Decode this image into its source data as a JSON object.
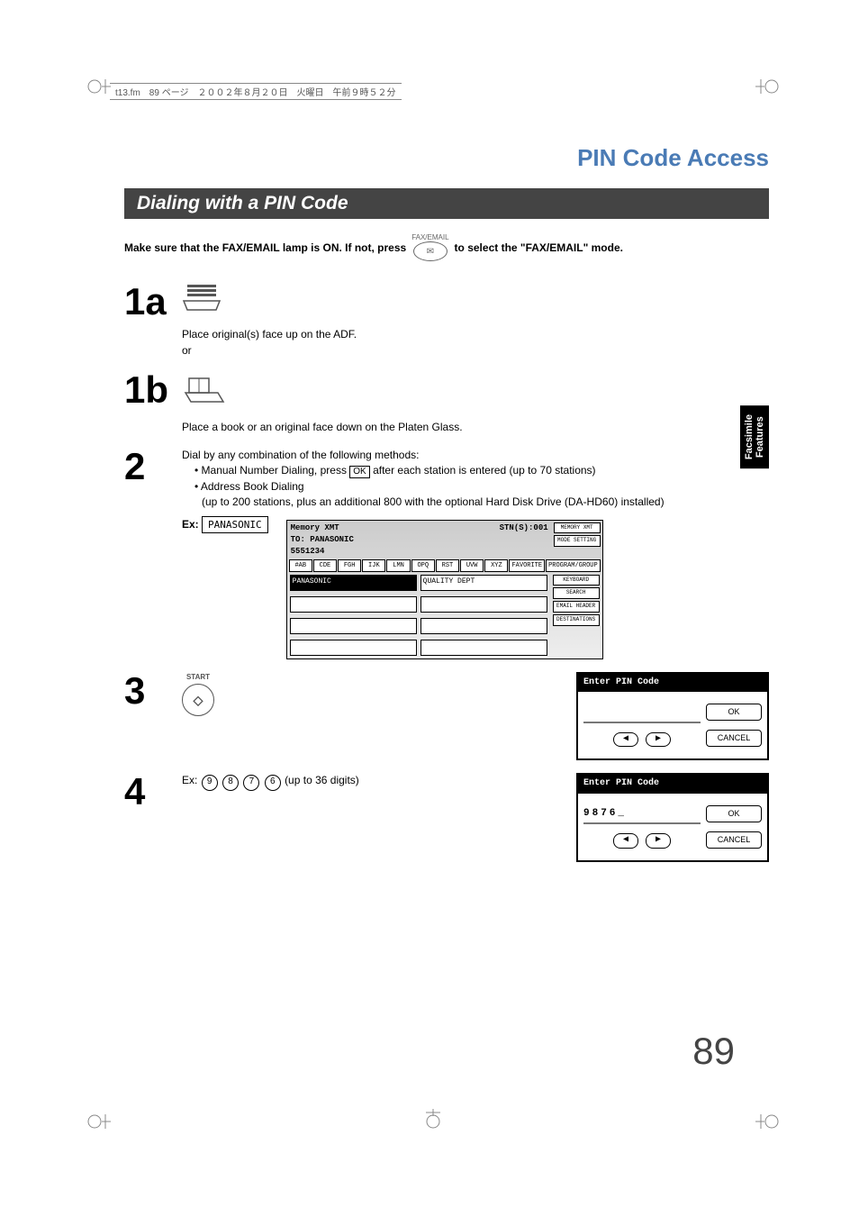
{
  "meta_header": "t13.fm　89 ページ　２００２年８月２０日　火曜日　午前９時５２分",
  "section_title": "PIN Code Access",
  "sub_bar": "Dialing with a PIN Code",
  "intro_part1": "Make sure that the FAX/EMAIL lamp is ON.  If not, press",
  "intro_part2": "to select the \"FAX/EMAIL\" mode.",
  "fax_email_label": "FAX/EMAIL",
  "step1a": {
    "num": "1a",
    "text1": "Place original(s) face up on the ADF.",
    "text2": "or"
  },
  "step1b": {
    "num": "1b",
    "text": "Place a book or an original face down on the Platen Glass."
  },
  "step2": {
    "num": "2",
    "line1": "Dial by any combination of the following methods:",
    "bullet1a": "• Manual Number Dialing, press ",
    "ok": "OK",
    "bullet1b": " after each station is entered (up to 70 stations)",
    "bullet2": "• Address Book Dialing",
    "bullet2b": "(up to 200 stations, plus an additional 800 with the optional Hard Disk Drive (DA-HD60) installed)",
    "ex_label": "Ex:",
    "ex_value": "PANASONIC"
  },
  "touchpanel": {
    "hdr1": "Memory XMT",
    "hdr2": "TO: PANASONIC",
    "hdr3": "5551234",
    "stn": "STN(S):001",
    "tabs": [
      "#AB",
      "CDE",
      "FGH",
      "IJK",
      "LMN",
      "OPQ",
      "RST",
      "UVW",
      "XYZ",
      "FAVORITE",
      "PROGRAM/GROUP"
    ],
    "cell1": "PANASONIC",
    "cell2": "QUALITY DEPT",
    "rt": [
      "MEMORY XMT",
      "MODE SETTING",
      "KEYBOARD",
      "SEARCH",
      "EMAIL HEADER",
      "DESTINATIONS"
    ]
  },
  "step3": {
    "num": "3",
    "start": "START"
  },
  "pin1": {
    "title": "Enter PIN Code",
    "value": "",
    "ok": "OK",
    "cancel": "CANCEL"
  },
  "step4": {
    "num": "4",
    "ex_label": "Ex:",
    "digits": [
      "9",
      "8",
      "7",
      "6"
    ],
    "note": "(up to 36 digits)"
  },
  "pin2": {
    "title": "Enter PIN Code",
    "value": "9876_",
    "ok": "OK",
    "cancel": "CANCEL"
  },
  "side_tab_1": "Facsimile",
  "side_tab_2": "Features",
  "page_number": "89"
}
